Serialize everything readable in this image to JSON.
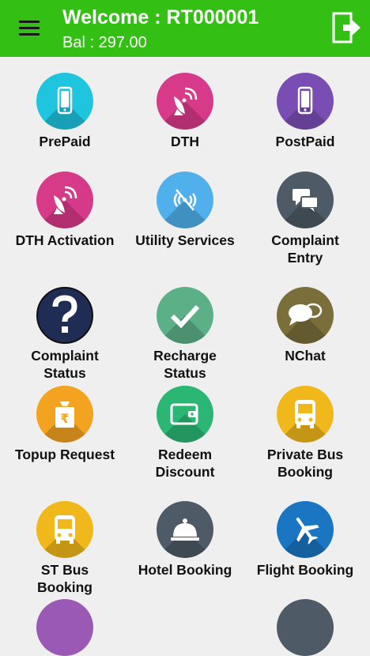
{
  "header": {
    "title": "Welcome : RT000001",
    "balance": "Bal : 297.00",
    "menu_icon": "hamburger-menu-icon",
    "logout_icon": "logout-icon",
    "bg_color": "#33bf13"
  },
  "tiles": [
    {
      "label": "PrePaid",
      "icon": "mobile-icon",
      "color": "#1fc4de"
    },
    {
      "label": "DTH",
      "icon": "satellite-dish-icon",
      "color": "#d83a8a"
    },
    {
      "label": "PostPaid",
      "icon": "mobile-icon",
      "color": "#7a4db5"
    },
    {
      "label": "DTH Activation",
      "icon": "satellite-dish-icon",
      "color": "#d83a8a"
    },
    {
      "label": "Utility Services",
      "icon": "no-signal-icon",
      "color": "#4fb0ec"
    },
    {
      "label": "Complaint Entry",
      "icon": "chat-bubbles-icon",
      "color": "#4e5a65"
    },
    {
      "label": "Complaint Status",
      "icon": "question-mark-icon",
      "color": "#1f2d55"
    },
    {
      "label": "Recharge Status",
      "icon": "check-mark-icon",
      "color": "#5cb088"
    },
    {
      "label": "NChat",
      "icon": "chat-bubbles-icon",
      "color": "#7a6e3a"
    },
    {
      "label": "Topup Request",
      "icon": "rupee-bag-icon",
      "color": "#f3a31f"
    },
    {
      "label": "Redeem Discount",
      "icon": "wallet-icon",
      "color": "#2bb673"
    },
    {
      "label": "Private Bus Booking",
      "icon": "bus-icon",
      "color": "#f1b81c"
    },
    {
      "label": "ST Bus Booking",
      "icon": "bus-icon",
      "color": "#f1b81c"
    },
    {
      "label": "Hotel Booking",
      "icon": "service-bell-icon",
      "color": "#4e5a65"
    },
    {
      "label": "Flight Booking",
      "icon": "airplane-icon",
      "color": "#1a75c2"
    }
  ]
}
